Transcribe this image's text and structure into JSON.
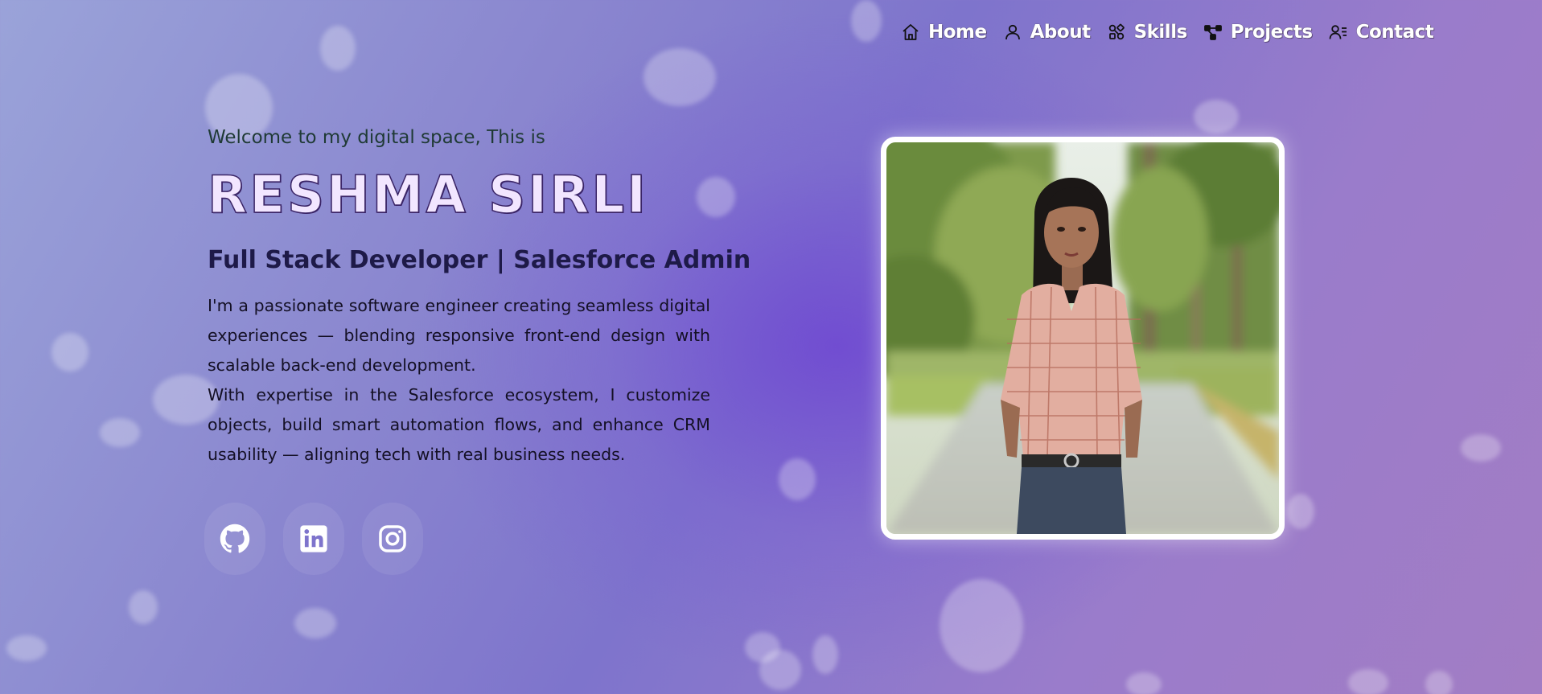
{
  "nav": {
    "items": [
      {
        "label": "Home",
        "icon": "home-icon"
      },
      {
        "label": "About",
        "icon": "user-icon"
      },
      {
        "label": "Skills",
        "icon": "skills-icon"
      },
      {
        "label": "Projects",
        "icon": "projects-icon"
      },
      {
        "label": "Contact",
        "icon": "contact-icon"
      }
    ]
  },
  "hero": {
    "welcome": "Welcome to my digital space, This is",
    "name": "RESHMA SIRLI",
    "role": "Full Stack Developer | Salesforce Admin",
    "description": [
      "I'm a passionate software engineer creating seamless digital experiences — blending responsive front-end design with scalable back-end development.",
      "With expertise in the Salesforce ecosystem, I customize objects, build smart automation flows, and enhance CRM usability — aligning tech with real business needs."
    ]
  },
  "socials": [
    {
      "icon": "github-icon"
    },
    {
      "icon": "linkedin-icon"
    },
    {
      "icon": "instagram-icon"
    }
  ],
  "photo": {
    "icon": "profile-photo"
  },
  "colors": {
    "accent": "#7050d0",
    "name_fill": "#f2e6ff",
    "name_outline": "#3a2466",
    "frame": "#ffffff"
  }
}
